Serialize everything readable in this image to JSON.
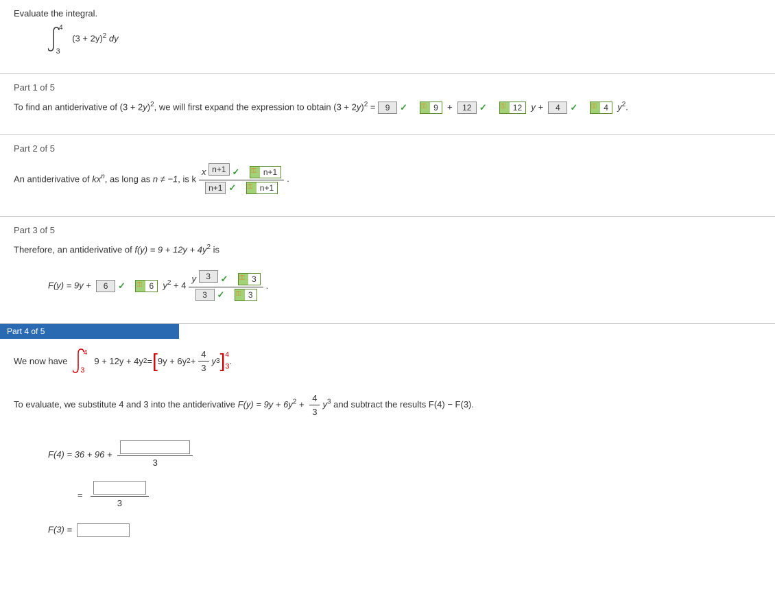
{
  "intro": {
    "instruction": "Evaluate the integral.",
    "integral_lower": "3",
    "integral_upper": "4",
    "integrand": "(3 + 2y)",
    "integrand_exp": "2",
    "integrand_diff": "dy"
  },
  "part1": {
    "title": "Part 1 of 5",
    "text_a": "To find an antiderivative of  (3 + 2",
    "text_b": ",  we will first expand the expression to obtain  (3 + 2",
    "ans1": "9",
    "key1": "9",
    "plus": "+",
    "ans2": "12",
    "key2": "12",
    "y_plus": "y  +",
    "ans3": "4",
    "key3": "4",
    "y_sq": "y",
    "y_var": "y",
    "two": "2",
    "eq": " = "
  },
  "part2": {
    "title": "Part 2 of 5",
    "text_a": "An antiderivative of  ",
    "kxn": "kx",
    "n_exp": "n",
    "text_b": ",  as long as  ",
    "ne_cond": "n ≠ −1",
    "is_k": ",  is  k",
    "x_var": "x",
    "ans_top": "n+1",
    "key_top": "n+1",
    "ans_bot": "n+1",
    "key_bot": "n+1"
  },
  "part3": {
    "title": "Part 3 of 5",
    "text_a": "Therefore, an antiderivative of  ",
    "fy": "f(y) = 9 + 12y + 4y",
    "two": "2",
    "is": "  is",
    "Fy": "F(y) = 9y +",
    "ans1": "6",
    "key1": "6",
    "y_sq": "y",
    "plus4": " + 4",
    "y_var": "y",
    "ans_top": "3",
    "key_top": "3",
    "ans_bot": "3",
    "key_bot": "3"
  },
  "part4": {
    "title": "Part 4 of 5",
    "we_now": "We now have",
    "int_lower": "3",
    "int_upper": "4",
    "integrand": "9 + 12y + 4y",
    "two": "2",
    "eq": " = ",
    "bracket_expr_a": "9y + 6y",
    "bracket_plus": " + ",
    "frac_num": "4",
    "frac_den": "3",
    "y_cubed": "y",
    "three": "3",
    "brac_upper": "4",
    "brac_lower": "3",
    "eval_text_a": "To evaluate, we substitute 4 and 3 into the antiderivative  ",
    "Fy_expr": "F(y) = 9y + 6y",
    "Fy_plus": " + ",
    "Fy_frac_num": "4",
    "Fy_frac_den": "3",
    "Fy_y": "y",
    "eval_text_b": "  and subtract the results  F(4) − F(3).",
    "F4_label": "F(4)  =  36 + 96 +",
    "F4_den": "3",
    "eq_sign": "=",
    "eq_den": "3",
    "F3_label": "F(3)  ="
  }
}
